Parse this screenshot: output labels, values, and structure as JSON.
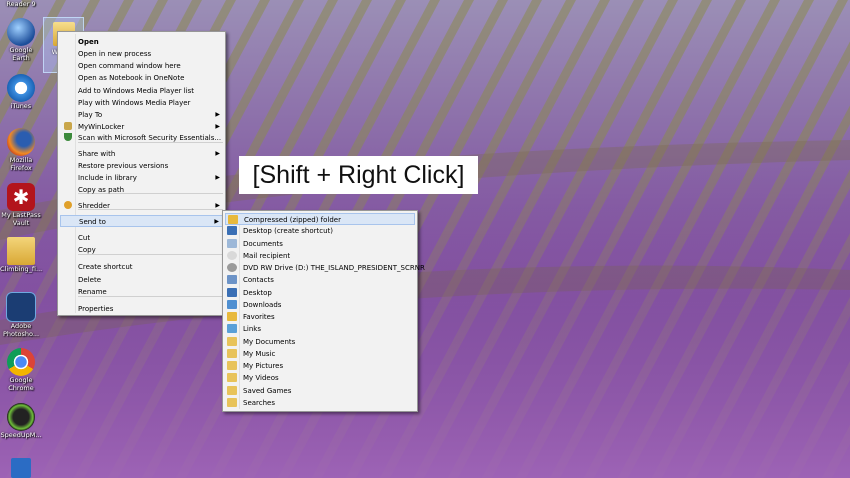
{
  "desktop": {
    "icons": [
      {
        "label": "Reader 9"
      },
      {
        "label": "Google Earth"
      },
      {
        "label": "iTunes"
      },
      {
        "label": "Mozilla Firefox"
      },
      {
        "label": "My LastPass Vault"
      },
      {
        "label": "Climbing_fi..."
      },
      {
        "label": "Adobe Photosho..."
      },
      {
        "label": "Google Chrome"
      },
      {
        "label": "SpeedUpM..."
      }
    ],
    "selected_item_label": "W... L..."
  },
  "caption": "[Shift + Right Click]",
  "context_menu": {
    "items": [
      {
        "label": "Open",
        "bold": true
      },
      {
        "label": "Open in new process"
      },
      {
        "label": "Open command window here"
      },
      {
        "label": "Open as Notebook in OneNote"
      },
      {
        "label": "Add to Windows Media Player list"
      },
      {
        "label": "Play with Windows Media Player"
      },
      {
        "label": "Play To",
        "submenu": true
      },
      {
        "label": "MyWinLocker",
        "submenu": true,
        "icon": "lock-icon"
      },
      {
        "label": "Scan with Microsoft Security Essentials...",
        "icon": "shield-icon"
      },
      {
        "label": "Share with",
        "submenu": true
      },
      {
        "label": "Restore previous versions"
      },
      {
        "label": "Include in library",
        "submenu": true
      },
      {
        "label": "Copy as path"
      },
      {
        "label": "Shredder",
        "submenu": true,
        "icon": "shredder-icon"
      },
      {
        "label": "Send to",
        "submenu": true,
        "highlighted": true
      },
      {
        "label": "Cut"
      },
      {
        "label": "Copy"
      },
      {
        "label": "Create shortcut"
      },
      {
        "label": "Delete"
      },
      {
        "label": "Rename"
      },
      {
        "label": "Properties"
      }
    ]
  },
  "sendto_menu": {
    "items": [
      {
        "label": "Compressed (zipped) folder",
        "icon": "zip-folder-icon",
        "color": "#e8b93c",
        "highlighted": true
      },
      {
        "label": "Desktop (create shortcut)",
        "icon": "desktop-icon",
        "color": "#3a6fb5"
      },
      {
        "label": "Documents",
        "icon": "documents-icon",
        "color": "#9db8d8"
      },
      {
        "label": "Mail recipient",
        "icon": "mail-icon",
        "color": "#d9d9d9"
      },
      {
        "label": "DVD RW Drive (D:) THE_ISLAND_PRESIDENT_SCRNR",
        "icon": "dvd-drive-icon",
        "color": "#9a9a9a"
      },
      {
        "label": "Contacts",
        "icon": "contacts-icon",
        "color": "#6c93c7"
      },
      {
        "label": "Desktop",
        "icon": "desktop-folder-icon",
        "color": "#3a6fb5"
      },
      {
        "label": "Downloads",
        "icon": "downloads-icon",
        "color": "#4f8fd1"
      },
      {
        "label": "Favorites",
        "icon": "favorites-icon",
        "color": "#e8b93c"
      },
      {
        "label": "Links",
        "icon": "links-icon",
        "color": "#5aa0d8"
      },
      {
        "label": "My Documents",
        "icon": "my-documents-icon",
        "color": "#e8c35a"
      },
      {
        "label": "My Music",
        "icon": "my-music-icon",
        "color": "#e8c35a"
      },
      {
        "label": "My Pictures",
        "icon": "my-pictures-icon",
        "color": "#e8c35a"
      },
      {
        "label": "My Videos",
        "icon": "my-videos-icon",
        "color": "#e8c35a"
      },
      {
        "label": "Saved Games",
        "icon": "saved-games-icon",
        "color": "#e8c35a"
      },
      {
        "label": "Searches",
        "icon": "searches-icon",
        "color": "#e8c35a"
      }
    ]
  }
}
